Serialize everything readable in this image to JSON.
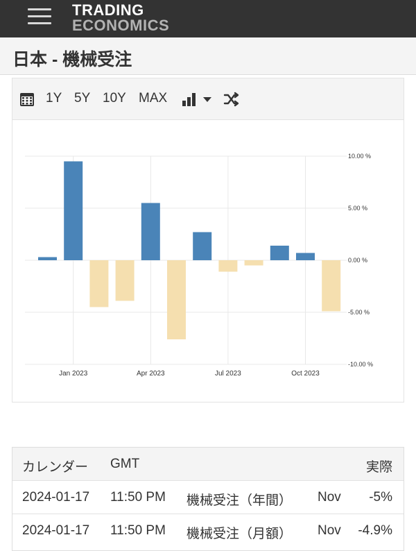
{
  "header": {
    "logo_line1": "TRADING",
    "logo_line2": "ECONOMICS",
    "menu_icon": "hamburger-menu-icon"
  },
  "page": {
    "title": "日本 - 機械受注"
  },
  "toolbar": {
    "calendar_icon": "calendar-icon",
    "range_1y": "1Y",
    "range_5y": "5Y",
    "range_10y": "10Y",
    "range_max": "MAX",
    "chart_type_icon": "bar-chart-icon",
    "dropdown_icon": "caret-down-icon",
    "shuffle_icon": "shuffle-icon"
  },
  "colors": {
    "positive": "#4a84b8",
    "negative": "#f5dfaf",
    "grid": "#e8e8e8"
  },
  "chart_data": {
    "type": "bar",
    "title": "",
    "xlabel": "",
    "ylabel": "",
    "ylim": [
      -10,
      10
    ],
    "y_ticks": [
      10,
      5,
      0,
      -5,
      -10
    ],
    "y_tick_labels": [
      "10.00 %",
      "5.00 %",
      "0.00 %",
      "-5.00 %",
      "-10.00 %"
    ],
    "x_tick_labels": [
      "Jan 2023",
      "Apr 2023",
      "Jul 2023",
      "Oct 2023"
    ],
    "x_tick_positions": [
      1,
      4,
      7,
      10
    ],
    "grid": true,
    "axis_position": "right",
    "values": [
      0.3,
      9.5,
      -4.5,
      -3.9,
      5.5,
      -7.6,
      2.7,
      -1.1,
      -0.5,
      1.4,
      0.7,
      -4.9
    ]
  },
  "table": {
    "headers": [
      "カレンダー",
      "GMT",
      "",
      "",
      "実際"
    ],
    "rows": [
      [
        "2024-01-17",
        "11:50 PM",
        "機械受注（年間）",
        "Nov",
        "-5%"
      ],
      [
        "2024-01-17",
        "11:50 PM",
        "機械受注（月額）",
        "Nov",
        "-4.9%"
      ]
    ]
  }
}
